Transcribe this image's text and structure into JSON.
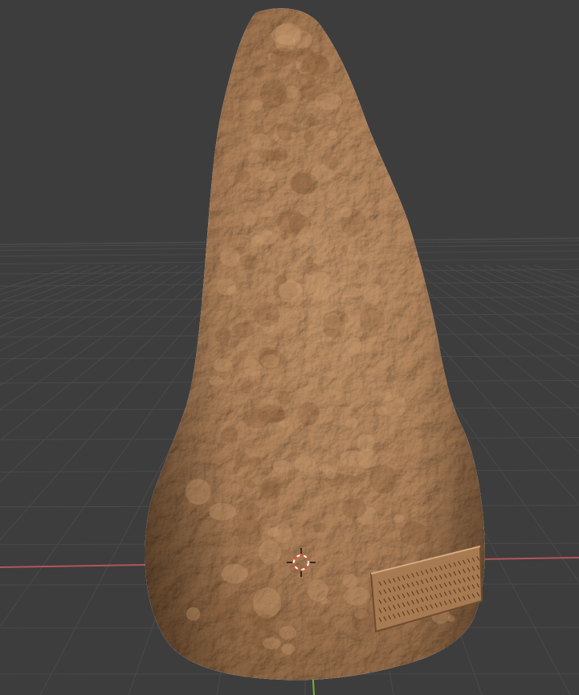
{
  "viewport": {
    "background_color": "#3d3d3d",
    "grid_color": "#4a4a4a",
    "x_axis_color": "#c85a60",
    "y_axis_color": "#7fbf3a"
  },
  "object": {
    "material_color": "#b0825a",
    "highlight_color": "#c99a70",
    "shadow_color": "#7a5535",
    "inscription_panel": true
  },
  "cursor": {
    "icon": "3d-cursor-icon",
    "ring_color_a": "#ffffff",
    "ring_color_b": "#e0503c"
  }
}
